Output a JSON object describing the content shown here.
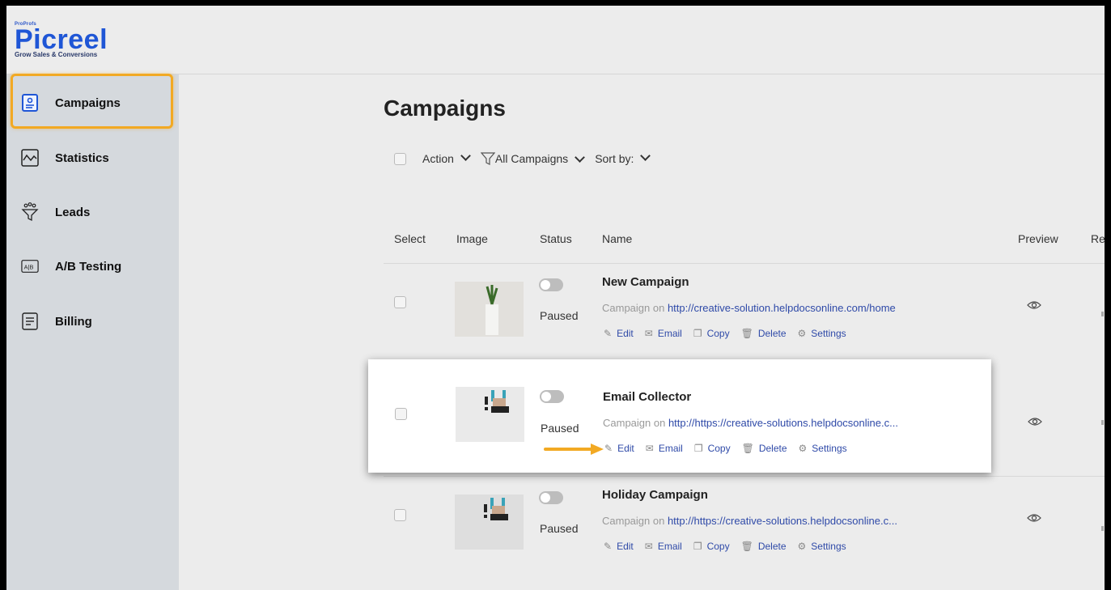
{
  "brand": {
    "small": "ProProfs",
    "name": "Picreel",
    "tagline": "Grow Sales & Conversions",
    "accent": "#1f56d6",
    "highlight_color": "#f2a923"
  },
  "sidebar": {
    "items": [
      {
        "label": "Campaigns",
        "icon": "campaigns-icon"
      },
      {
        "label": "Statistics",
        "icon": "statistics-icon"
      },
      {
        "label": "Leads",
        "icon": "leads-funnel-icon"
      },
      {
        "label": "A/B Testing",
        "icon": "ab-testing-icon"
      },
      {
        "label": "Billing",
        "icon": "billing-icon"
      }
    ]
  },
  "page": {
    "title": "Campaigns"
  },
  "toolbar": {
    "action": "Action",
    "filter": "All Campaigns",
    "sort": "Sort by:"
  },
  "table": {
    "headers": [
      "Select",
      "Image",
      "Status",
      "Name",
      "Preview",
      "Rep"
    ],
    "rows": [
      {
        "name": "New Campaign",
        "status": "Paused",
        "desc_prefix": "Campaign on",
        "url": "http://creative-solution.helpdocsonline.com/home",
        "image": "plant"
      },
      {
        "name": "Email Collector",
        "status": "Paused",
        "desc_prefix": "Campaign on",
        "url": "http://https://creative-solutions.helpdocsonline.c...",
        "image": "person"
      },
      {
        "name": "Holiday Campaign",
        "status": "Paused",
        "desc_prefix": "Campaign on",
        "url": "http://https://creative-solutions.helpdocsonline.c...",
        "image": "person"
      }
    ],
    "actions": [
      "Edit",
      "Email",
      "Copy",
      "Delete",
      "Settings"
    ]
  }
}
